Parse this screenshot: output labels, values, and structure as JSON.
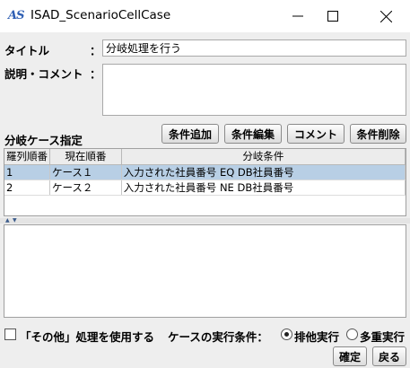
{
  "window": {
    "app_icon_text": "AS",
    "title": "ISAD_ScenarioCellCase",
    "minimize_icon": "minimize-icon",
    "maximize_icon": "maximize-icon",
    "close_icon": "close-icon"
  },
  "form": {
    "title_label": "タイトル",
    "title_colon": "：",
    "title_value": "分岐処理を行う",
    "desc_label": "説明・コメント",
    "desc_colon": "：",
    "desc_value": ""
  },
  "cases": {
    "section_label": "分岐ケース指定",
    "buttons": {
      "add": "条件追加",
      "edit": "条件編集",
      "comment": "コメント",
      "delete": "条件削除"
    },
    "columns": [
      "羅列順番",
      "現在順番",
      "分岐条件"
    ],
    "rows": [
      {
        "order": "1",
        "current": "ケース１",
        "condition": "入力された社員番号 EQ DB社員番号",
        "selected": true
      },
      {
        "order": "2",
        "current": "ケース２",
        "condition": "入力された社員番号 NE DB社員番号",
        "selected": false
      }
    ]
  },
  "splitter": {
    "up_arrow": "▲",
    "down_arrow": "▼"
  },
  "options": {
    "other_checkbox_label": "「その他」処理を使用する",
    "other_checked": false,
    "exec_condition_label": "ケースの実行条件：",
    "radio_exclusive": "排他実行",
    "radio_multiple": "多重実行",
    "selected_radio": "排他実行"
  },
  "footer": {
    "ok": "確定",
    "back": "戻る"
  }
}
